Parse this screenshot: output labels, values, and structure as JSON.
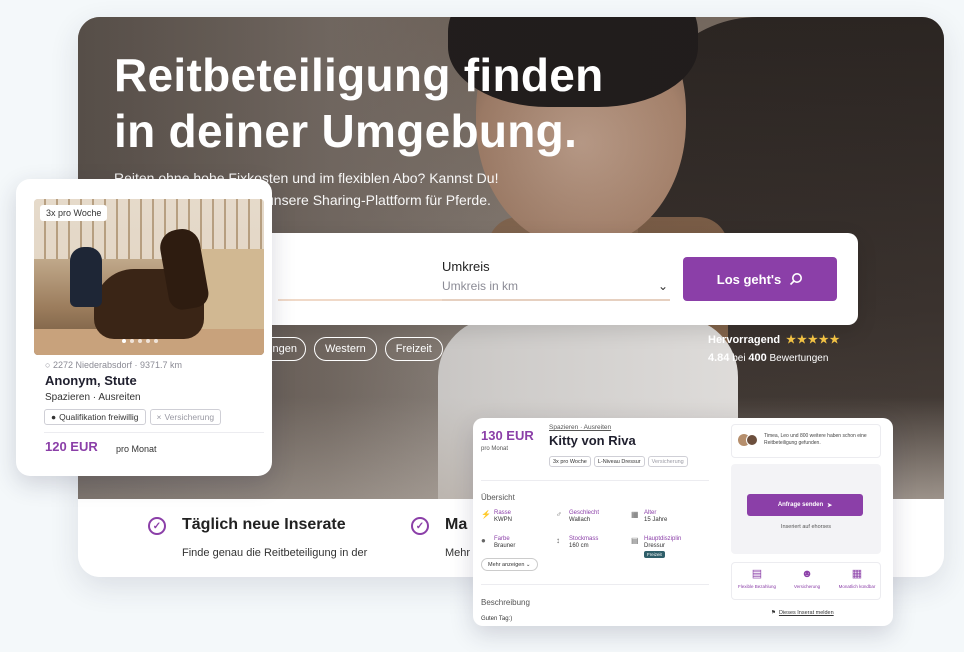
{
  "hero": {
    "title_line1": "Reitbeteiligung finden",
    "title_line2": "in deiner Umgebung.",
    "subtitle_line1": "Reiten ohne hohe Fixkosten und im flexiblen Abo? Kannst Du!",
    "subtitle_line2": "unsere Sharing-Plattform für Pferde."
  },
  "search": {
    "radius_label": "Umkreis",
    "radius_placeholder": "Umkreis in km",
    "submit_label": "Los geht's"
  },
  "filters": [
    "ungen",
    "Western",
    "Freizeit"
  ],
  "rating": {
    "label": "Hervorragend",
    "stars": "★★★★★",
    "score": "4.84",
    "text_mid": "bei",
    "count": "400",
    "text_end": "Bewertungen"
  },
  "features": [
    {
      "title": "Täglich neue Inserate",
      "desc": "Finde genau die Reitbeteiligung in der"
    },
    {
      "title": "Ma",
      "desc": "Mehr"
    }
  ],
  "listing": {
    "badge": "3x pro Woche",
    "location": "2272 Niederabsdorf · 9371.7 km",
    "name": "Anonym, Stute",
    "type": "Spazieren · Ausreiten",
    "tag1": "Qualifikation freiwillig",
    "tag2": "Versicherung",
    "price": "120 EUR",
    "per": "pro Monat"
  },
  "detail": {
    "price": "130 EUR",
    "per": "pro Monat",
    "breadcrumb": "Spazieren · Ausreiten",
    "title": "Kitty von Riva",
    "tags": [
      "3x pro Woche",
      "L-Niveau Dressur",
      "Versicherung"
    ],
    "overview_label": "Übersicht",
    "attributes": [
      {
        "key": "Rasse",
        "value": "KWPN"
      },
      {
        "key": "Geschlecht",
        "value": "Wallach"
      },
      {
        "key": "Alter",
        "value": "15 Jahre"
      },
      {
        "key": "Farbe",
        "value": "Brauner"
      },
      {
        "key": "Stockmass",
        "value": "160 cm"
      },
      {
        "key": "Hauptdisziplin",
        "value": "Dressur"
      }
    ],
    "new_badge": "Freizeit",
    "more_label": "Mehr anzeigen",
    "description_label": "Beschreibung",
    "description_text": "Guten Tag:)",
    "social_text": "Timea, Leo und 800 weitere haben schon eine Reitbeteiligung gefunden.",
    "request_label": "Anfrage senden",
    "request_sub": "Inseriert auf ehorses",
    "benefits": [
      "Flexible Bezahlung",
      "Versicherung",
      "Monatlich kündbar"
    ],
    "report_label": "Dieses Inserat melden"
  }
}
